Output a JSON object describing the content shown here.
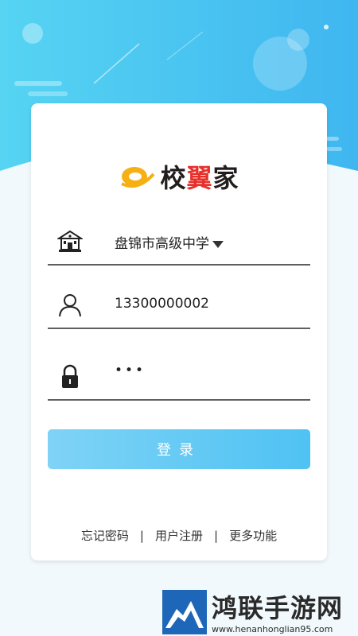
{
  "background": {
    "top_color": "#44c4f2",
    "bottom_color": "#f2f9fd"
  },
  "logo": {
    "brand_part1": "校",
    "brand_part2": "翼",
    "brand_part3": "家",
    "accent_color": "#e8302b"
  },
  "form": {
    "school": {
      "value": "盘锦市高级中学",
      "icon": "school-building-icon"
    },
    "username": {
      "value": "13300000002",
      "icon": "user-icon"
    },
    "password": {
      "masked_value": "•••",
      "icon": "lock-icon"
    }
  },
  "login_button": {
    "label": "登录",
    "color": "#5cc6f4"
  },
  "links": {
    "forgot_password": "忘记密码",
    "register": "用户注册",
    "more_features": "更多功能",
    "separator": "|"
  },
  "watermark": {
    "title": "鸿联手游网",
    "url": "www.henanhonglian95.com"
  }
}
